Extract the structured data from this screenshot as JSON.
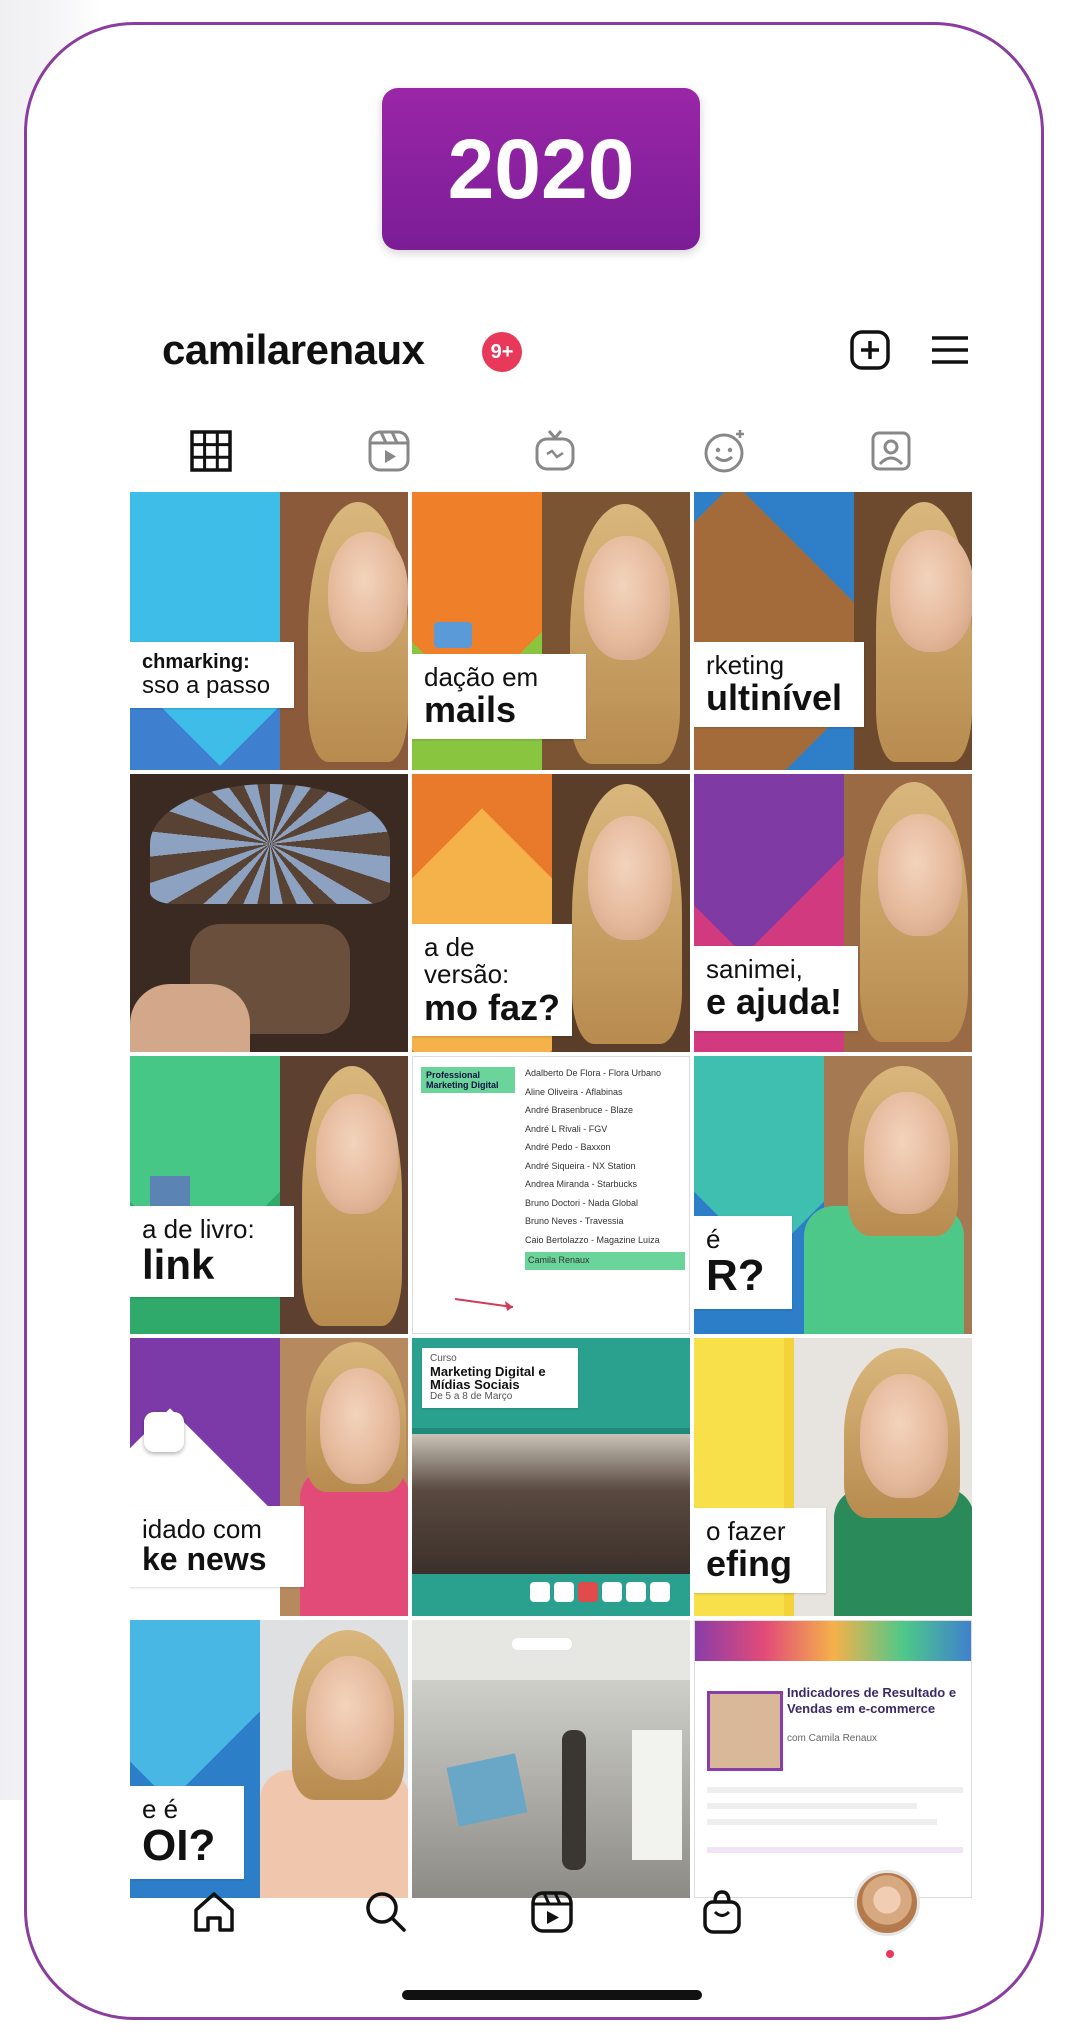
{
  "year_label": "2020",
  "profile": {
    "username": "camilarenaux",
    "notification_count": "9+"
  },
  "header_icons": [
    "plus-square-icon",
    "hamburger-menu-icon"
  ],
  "tabs": [
    {
      "name": "grid",
      "icon": "grid-icon",
      "active": true
    },
    {
      "name": "reels",
      "icon": "reels-icon",
      "active": false
    },
    {
      "name": "igtv",
      "icon": "igtv-icon",
      "active": false
    },
    {
      "name": "effects",
      "icon": "effects-icon",
      "active": false
    },
    {
      "name": "tagged",
      "icon": "tagged-icon",
      "active": false
    }
  ],
  "posts": [
    {
      "line1": "chmarking:",
      "line2": "sso a passo"
    },
    {
      "line1": "dação em",
      "line2": "mails"
    },
    {
      "line1": "rketing",
      "line2": "ultinível"
    },
    {
      "line1": "",
      "line2": ""
    },
    {
      "line1": "a de",
      "line1b": "versão:",
      "line2": "mo faz?"
    },
    {
      "line1": "sanimei,",
      "line2": "e ajuda!"
    },
    {
      "line1": "a de livro:",
      "line2": "link"
    },
    {
      "doc_tag": "Professional Marketing Digital"
    },
    {
      "line1": "é",
      "line2": "R?"
    },
    {
      "line1": "idado com",
      "line2": "ke news"
    },
    {
      "event_label": "Curso",
      "event_title": "Marketing Digital e Mídias Sociais",
      "event_sub": "De 5 a 8 de Março"
    },
    {
      "line1": "o fazer",
      "line2": "efing"
    },
    {
      "line1": "e é",
      "line2": "OI?"
    },
    {
      "line1": "",
      "line2": ""
    },
    {
      "flyer_title": "Indicadores de Resultado e Vendas em e-commerce",
      "flyer_sub": "com Camila Renaux"
    }
  ],
  "doc_names": [
    "Adalberto De Flora - Flora Urbano",
    "Aline Oliveira - Aflabinas",
    "André Brasenbruce - Blaze",
    "André L Rivali - FGV",
    "André Pedo - Baxxon",
    "André Siqueira - NX Station",
    "Andrea Miranda - Starbucks",
    "Bruno Doctori - Nada Global",
    "Bruno Neves - Travessia",
    "Caio Bertolazzo - Magazine Luiza",
    "Camila Renaux"
  ],
  "bottom_nav": [
    {
      "name": "home",
      "icon": "home-icon"
    },
    {
      "name": "search",
      "icon": "search-icon"
    },
    {
      "name": "reels",
      "icon": "reels-icon"
    },
    {
      "name": "shop",
      "icon": "shopping-bag-icon"
    },
    {
      "name": "profile",
      "icon": "avatar"
    }
  ],
  "colors": {
    "frame_border": "#8a3d9e",
    "badge_purple": "#8c22a2",
    "notification_red": "#e8395a"
  }
}
